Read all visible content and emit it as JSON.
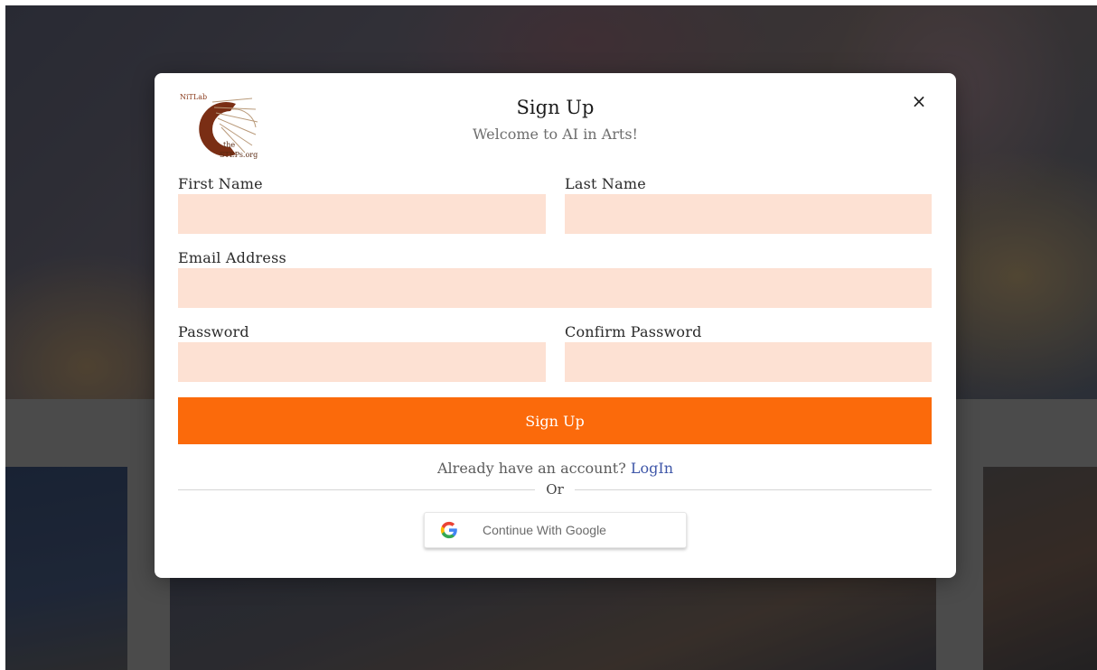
{
  "logo": {
    "top_text": "NiTLab",
    "line1": "the",
    "line2": "STEPs.org"
  },
  "modal": {
    "title": "Sign Up",
    "subtitle": "Welcome to AI in Arts!",
    "close_symbol": "×"
  },
  "form": {
    "first_name_label": "First Name",
    "last_name_label": "Last Name",
    "email_label": "Email Address",
    "password_label": "Password",
    "confirm_password_label": "Confirm Password",
    "first_name_value": "",
    "last_name_value": "",
    "email_value": "",
    "password_value": "",
    "confirm_password_value": "",
    "submit_label": "Sign Up"
  },
  "footer": {
    "account_prompt": "Already have an account?",
    "login_link": "LogIn",
    "or_text": "Or",
    "google_label": "Continue With Google"
  },
  "colors": {
    "accent": "#fb6a0b",
    "field_background": "#fde1d3",
    "link": "#3e56a8"
  },
  "icons": {
    "close": "close-icon",
    "google": "google-icon"
  }
}
